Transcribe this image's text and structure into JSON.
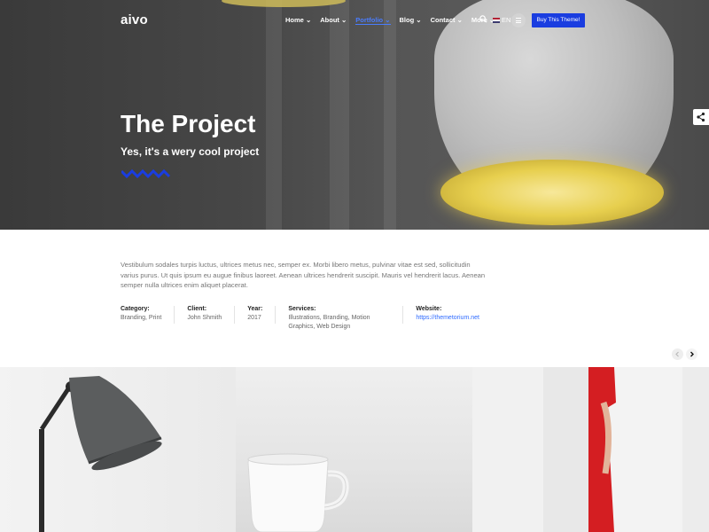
{
  "brand": {
    "logo": "aivo"
  },
  "nav": {
    "items": [
      {
        "label": "Home",
        "active": false
      },
      {
        "label": "About",
        "active": false
      },
      {
        "label": "Portfolio",
        "active": true
      },
      {
        "label": "Blog",
        "active": false
      },
      {
        "label": "Contact",
        "active": false
      },
      {
        "label": "More",
        "active": false
      }
    ],
    "language": "EN",
    "cta": "Buy This Theme!"
  },
  "hero": {
    "title": "The Project",
    "subtitle": "Yes, it's a wery cool project"
  },
  "project": {
    "description": "Vestibulum sodales turpis luctus, ultrices metus nec, semper ex. Morbi libero metus, pulvinar vitae est sed, sollicitudin varius purus. Ut quis ipsum eu augue finibus laoreet. Aenean ultrices hendrerit suscipit. Mauris vel hendrerit lacus. Aenean semper nulla ultrices enim aliquet placerat.",
    "meta": [
      {
        "label": "Category:",
        "value": "Branding, Print"
      },
      {
        "label": "Client:",
        "value": "John Shmith"
      },
      {
        "label": "Year:",
        "value": "2017"
      },
      {
        "label": "Services:",
        "value": "Illustrations, Branding, Motion Graphics, Web Design"
      },
      {
        "label": "Website:",
        "value": "https://themetorium.net"
      }
    ]
  },
  "colors": {
    "accent": "#1a3de0",
    "link": "#2f6bff",
    "active_nav": "#4a7dff"
  },
  "icons": [
    "search-icon",
    "hamburger-icon",
    "share-icon",
    "chevron-left-icon",
    "chevron-right-icon",
    "flag-us-icon",
    "chevron-down-icon",
    "zigzag-icon"
  ]
}
